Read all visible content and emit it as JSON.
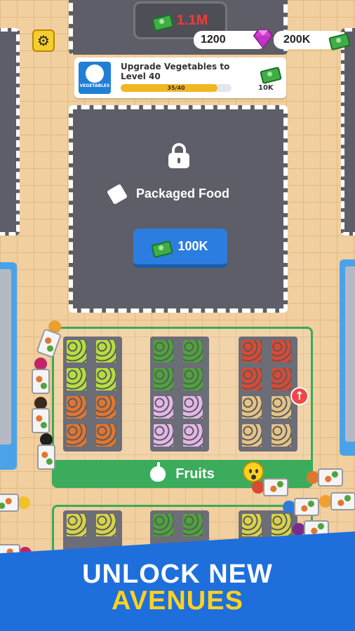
{
  "hud": {
    "money_total": "1.1M",
    "gems": "1200",
    "cash": "200K"
  },
  "upgrade": {
    "icon_label": "VEGETABLES",
    "title": "Upgrade Vegetables to Level 40",
    "progress_text": "35/40",
    "progress_fraction": 0.875,
    "cost": "10K"
  },
  "locked_zone": {
    "name": "Packaged Food",
    "price": "100K"
  },
  "fruits_section": {
    "label": "Fruits"
  },
  "banner": {
    "line1": "UNLOCK NEW",
    "line2": "AVENUES"
  },
  "colors": {
    "floor": "#f1cf9f",
    "zone_gray": "#5d5e67",
    "accent_blue": "#2c7de0",
    "section_green": "#3aac5c",
    "banner_blue": "#1e6fdc",
    "banner_yellow": "#ffd21f",
    "money_red": "#ff3535"
  },
  "icons": [
    "gear-icon",
    "cash-icon",
    "gem-icon",
    "lock-icon",
    "package-icon",
    "apple-icon",
    "upgrade-arrow-icon",
    "surprised-emoji-icon"
  ]
}
